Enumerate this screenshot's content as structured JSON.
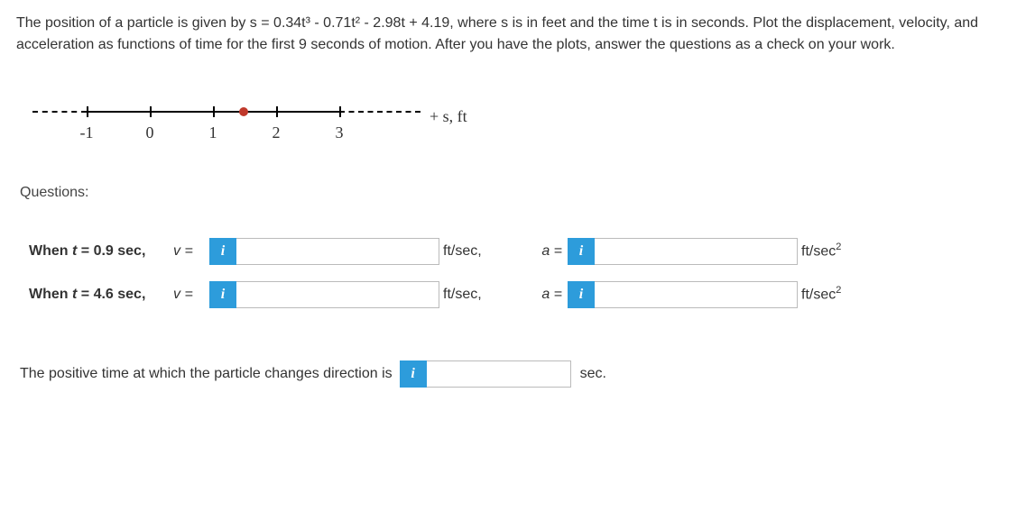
{
  "problem": {
    "text": "The position of a particle is given by s = 0.34t³ - 0.71t² - 2.98t + 4.19, where s is in feet and the time t is in seconds. Plot the displacement, velocity, and acceleration as functions of time for the first 9 seconds of motion. After you have the plots, answer the questions as a check on your work."
  },
  "numberline": {
    "ticks": [
      "-1",
      "0",
      "1",
      "2",
      "3"
    ],
    "axis_label": "+ s, ft"
  },
  "questions_heading": "Questions:",
  "rows": [
    {
      "t_label": "When t = 0.9 sec,",
      "v_eq": "v =",
      "v_val": "",
      "v_unit": "ft/sec,",
      "a_eq": "a =",
      "a_val": "",
      "a_unit_pre": "ft/sec",
      "a_unit_sup": "2"
    },
    {
      "t_label": "When t = 4.6 sec,",
      "v_eq": "v =",
      "v_val": "",
      "v_unit": "ft/sec,",
      "a_eq": "a =",
      "a_val": "",
      "a_unit_pre": "ft/sec",
      "a_unit_sup": "2"
    }
  ],
  "bottom": {
    "text": "The positive time at which the particle changes direction is",
    "val": "",
    "unit": "sec."
  },
  "info_glyph": "i"
}
